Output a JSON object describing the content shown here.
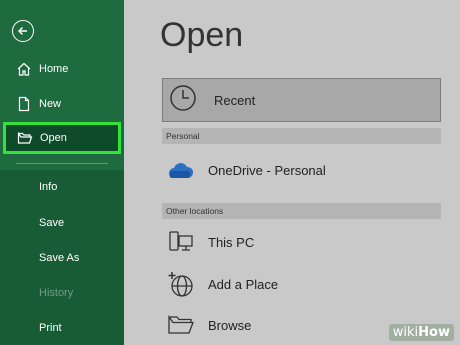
{
  "sidebar": {
    "items": [
      {
        "label": "Home",
        "icon": "home-icon"
      },
      {
        "label": "New",
        "icon": "new-file-icon"
      },
      {
        "label": "Open",
        "icon": "folder-open-icon"
      },
      {
        "label": "Info"
      },
      {
        "label": "Save"
      },
      {
        "label": "Save As"
      },
      {
        "label": "History"
      },
      {
        "label": "Print"
      }
    ],
    "highlight_color": "#33e23a"
  },
  "main": {
    "title": "Open",
    "recent_label": "Recent",
    "personal_section": "Personal",
    "onedrive_label": "OneDrive - Personal",
    "other_section": "Other locations",
    "this_pc_label": "This PC",
    "add_place_label": "Add a Place",
    "browse_label": "Browse"
  },
  "watermark": {
    "prefix": "wiki",
    "suffix": "How"
  }
}
